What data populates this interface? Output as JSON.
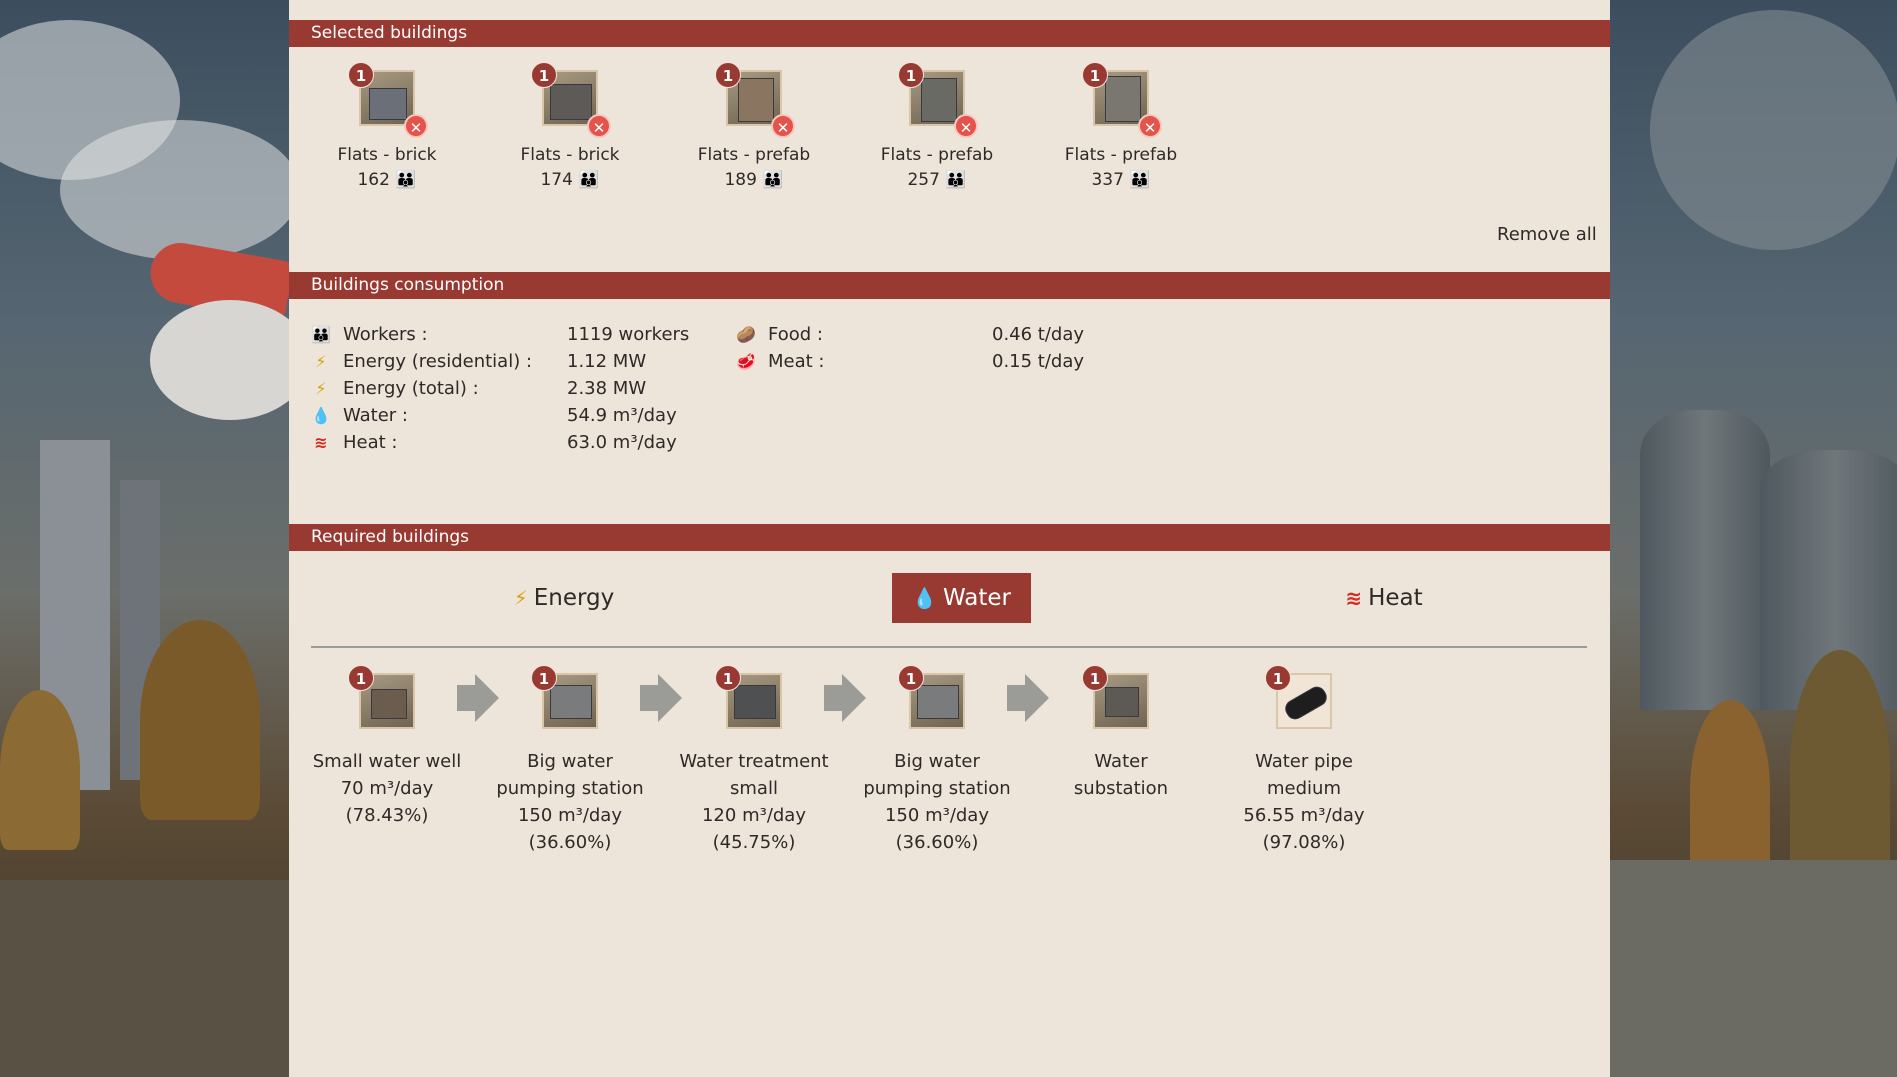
{
  "sections": {
    "selected": "Selected buildings",
    "consumption": "Buildings consumption",
    "required": "Required buildings"
  },
  "selected_buildings": [
    {
      "badge": "1",
      "name": "Flats - brick",
      "count": "162"
    },
    {
      "badge": "1",
      "name": "Flats - brick",
      "count": "174"
    },
    {
      "badge": "1",
      "name": "Flats - prefab",
      "count": "189"
    },
    {
      "badge": "1",
      "name": "Flats - prefab",
      "count": "257"
    },
    {
      "badge": "1",
      "name": "Flats - prefab",
      "count": "337"
    }
  ],
  "remove_all_label": "Remove all",
  "consumption": {
    "left": [
      {
        "icon": "workers-icon",
        "label": "Workers :",
        "value": "1119 workers"
      },
      {
        "icon": "energy-icon",
        "label": "Energy (residential) :",
        "value": "1.12 MW"
      },
      {
        "icon": "energy-icon",
        "label": "Energy (total) :",
        "value": "2.38 MW"
      },
      {
        "icon": "water-drop-icon",
        "label": "Water :",
        "value": "54.9 m³/day"
      },
      {
        "icon": "heat-icon",
        "label": "Heat :",
        "value": "63.0 m³/day"
      }
    ],
    "right": [
      {
        "icon": "food-icon",
        "label": "Food :",
        "value": "0.46 t/day"
      },
      {
        "icon": "meat-icon",
        "label": "Meat :",
        "value": "0.15 t/day"
      }
    ]
  },
  "tabs": [
    {
      "label": "Energy",
      "icon": "energy-icon",
      "active": false
    },
    {
      "label": "Water",
      "icon": "water-drop-icon",
      "active": true
    },
    {
      "label": "Heat",
      "icon": "heat-icon",
      "active": false
    }
  ],
  "chain": [
    {
      "badge": "1",
      "name_line1": "Small water well",
      "name_line2": "70 m³/day",
      "name_line3": "(78.43%)",
      "name_line4": ""
    },
    {
      "badge": "1",
      "name_line1": "Big water",
      "name_line2": "pumping station",
      "name_line3": "150 m³/day",
      "name_line4": "(36.60%)"
    },
    {
      "badge": "1",
      "name_line1": "Water treatment",
      "name_line2": "small",
      "name_line3": "120 m³/day",
      "name_line4": "(45.75%)"
    },
    {
      "badge": "1",
      "name_line1": "Big water",
      "name_line2": "pumping station",
      "name_line3": "150 m³/day",
      "name_line4": "(36.60%)"
    },
    {
      "badge": "1",
      "name_line1": "Water substation",
      "name_line2": "",
      "name_line3": "",
      "name_line4": ""
    },
    {
      "badge": "1",
      "name_line1": "Water pipe",
      "name_line2": "medium",
      "name_line3": "56.55 m³/day",
      "name_line4": "(97.08%)"
    }
  ],
  "colors": {
    "header_red": "#983a32",
    "panel_bg": "#ede4da",
    "badge_red": "#983a32",
    "remove_red": "#e5534b"
  }
}
